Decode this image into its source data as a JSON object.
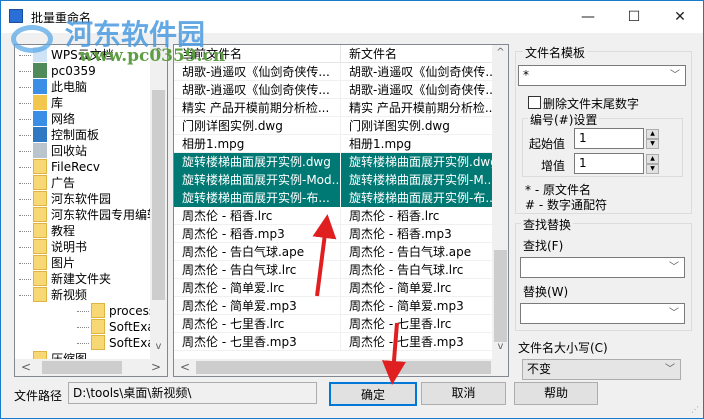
{
  "window": {
    "title": "批量重命名",
    "minimize": "—",
    "maximize": "☐",
    "close": "✕"
  },
  "watermark": {
    "name": "河东软件园",
    "url": "www.pc0359.cn"
  },
  "tree": {
    "items": [
      {
        "label": "WPS云文档",
        "icon": "cloud-icon",
        "level": 0
      },
      {
        "label": "pc0359",
        "icon": "user-icon",
        "level": 0
      },
      {
        "label": "此电脑",
        "icon": "computer-icon",
        "level": 0
      },
      {
        "label": "库",
        "icon": "library-icon",
        "level": 0
      },
      {
        "label": "网络",
        "icon": "network-icon",
        "level": 0
      },
      {
        "label": "控制面板",
        "icon": "control-panel-icon",
        "level": 0
      },
      {
        "label": "回收站",
        "icon": "recycle-bin-icon",
        "level": 0
      },
      {
        "label": "FileRecv",
        "icon": "folder-icon",
        "level": 0
      },
      {
        "label": "广告",
        "icon": "folder-icon",
        "level": 0
      },
      {
        "label": "河东软件园",
        "icon": "folder-icon",
        "level": 0
      },
      {
        "label": "河东软件园专用编辑",
        "icon": "folder-icon",
        "level": 0
      },
      {
        "label": "教程",
        "icon": "folder-icon",
        "level": 0
      },
      {
        "label": "说明书",
        "icon": "folder-icon",
        "level": 0
      },
      {
        "label": "图片",
        "icon": "folder-icon",
        "level": 0
      },
      {
        "label": "新建文件夹",
        "icon": "folder-icon",
        "level": 0
      },
      {
        "label": "新视频",
        "icon": "folder-icon",
        "level": 0
      },
      {
        "label": "processed",
        "icon": "folder-icon",
        "level": 1
      },
      {
        "label": "SoftExamConfig",
        "icon": "folder-icon",
        "level": 1
      },
      {
        "label": "SoftExamConfig",
        "icon": "folder-icon",
        "level": 1
      },
      {
        "label": "压缩图",
        "icon": "folder-icon",
        "level": 0
      }
    ]
  },
  "files": {
    "headers": [
      "当前文件名",
      "新文件名"
    ],
    "rows": [
      {
        "cur": "胡歌-逍遥叹《仙剑奇侠传...",
        "new": "胡歌-逍遥叹《仙剑奇侠传...",
        "sel": false
      },
      {
        "cur": "胡歌-逍遥叹《仙剑奇侠传...",
        "new": "胡歌-逍遥叹《仙剑奇侠传...",
        "sel": false
      },
      {
        "cur": "精实  产品开模前期分析检...",
        "new": "精实  产品开模前期分析检...",
        "sel": false
      },
      {
        "cur": "门刚详图实例.dwg",
        "new": "门刚详图实例.dwg",
        "sel": false
      },
      {
        "cur": "相册1.mpg",
        "new": "相册1.mpg",
        "sel": false
      },
      {
        "cur": "旋转楼梯曲面展开实例.dwg",
        "new": "旋转楼梯曲面展开实例.dwg",
        "sel": true
      },
      {
        "cur": "旋转楼梯曲面展开实例-Mod...",
        "new": "旋转楼梯曲面展开实例-M...",
        "sel": true
      },
      {
        "cur": "旋转楼梯曲面展开实例-布...",
        "new": "旋转楼梯曲面展开实例-布...",
        "sel": true
      },
      {
        "cur": "周杰伦 - 稻香.lrc",
        "new": "周杰伦 - 稻香.lrc",
        "sel": false
      },
      {
        "cur": "周杰伦 - 稻香.mp3",
        "new": "周杰伦 - 稻香.mp3",
        "sel": false
      },
      {
        "cur": "周杰伦 - 告白气球.ape",
        "new": "周杰伦 - 告白气球.ape",
        "sel": false
      },
      {
        "cur": "周杰伦 - 告白气球.lrc",
        "new": "周杰伦 - 告白气球.lrc",
        "sel": false
      },
      {
        "cur": "周杰伦 - 简单爱.lrc",
        "new": "周杰伦 - 简单爱.lrc",
        "sel": false
      },
      {
        "cur": "周杰伦 - 简单爱.mp3",
        "new": "周杰伦 - 简单爱.mp3",
        "sel": false
      },
      {
        "cur": "周杰伦 - 七里香.lrc",
        "new": "周杰伦 - 七里香.lrc",
        "sel": false
      },
      {
        "cur": "周杰伦 - 七里香.mp3",
        "new": "周杰伦 - 七里香.mp3",
        "sel": false
      }
    ]
  },
  "right": {
    "template_group": "文件名模板",
    "template_value": "*",
    "delete_trailing_digits": "删除文件末尾数字",
    "numbering_group": "编号(#)设置",
    "start_label": "起始值",
    "start_value": "1",
    "step_label": "增值",
    "step_value": "1",
    "hint1": "* - 原文件名",
    "hint2": "# - 数字通配符",
    "find_group": "查找替换",
    "find_label": "查找(F)",
    "find_value": "",
    "replace_label": "替换(W)",
    "replace_value": "",
    "case_label": "文件名大小写(C)",
    "case_value": "不变"
  },
  "bottom": {
    "path_label": "文件路径",
    "path_value": "D:\\tools\\桌面\\新视频\\",
    "ok": "确定",
    "cancel": "取消",
    "help": "帮助"
  },
  "colors": {
    "selection": "#007873",
    "accent": "#1979ca",
    "arrow": "#e02020"
  }
}
